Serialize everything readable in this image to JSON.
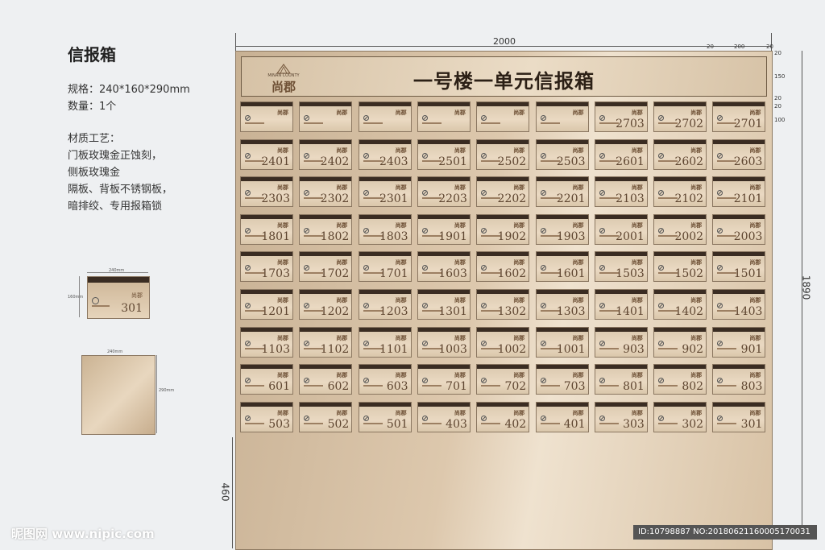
{
  "sidebar": {
    "title": "信报箱",
    "spec_size": "规格：240*160*290mm",
    "spec_qty": "数量：1个",
    "craft_title": "材质工艺：",
    "craft_lines": [
      "门板玫瑰金正蚀刻，",
      "侧板玫瑰金",
      "隔板、背板不锈钢板，",
      "暗排绞、专用报箱锁"
    ]
  },
  "panel": {
    "title": "一号楼一单元信报箱",
    "logo_en": "MINAN COUNTY",
    "logo_cn": "尚郡",
    "box_emblem": "尚郡"
  },
  "mailboxes": [
    [
      "",
      "",
      "",
      "",
      "",
      "",
      "2703",
      "2702",
      "2701"
    ],
    [
      "2401",
      "2402",
      "2403",
      "2501",
      "2502",
      "2503",
      "2601",
      "2602",
      "2603"
    ],
    [
      "2303",
      "2302",
      "2301",
      "2203",
      "2202",
      "2201",
      "2103",
      "2102",
      "2101"
    ],
    [
      "1801",
      "1802",
      "1803",
      "1901",
      "1902",
      "1903",
      "2001",
      "2002",
      "2003"
    ],
    [
      "1703",
      "1702",
      "1701",
      "1603",
      "1602",
      "1601",
      "1503",
      "1502",
      "1501"
    ],
    [
      "1201",
      "1202",
      "1203",
      "1301",
      "1302",
      "1303",
      "1401",
      "1402",
      "1403"
    ],
    [
      "1103",
      "1102",
      "1101",
      "1003",
      "1002",
      "1001",
      "903",
      "902",
      "901"
    ],
    [
      "601",
      "602",
      "603",
      "701",
      "702",
      "703",
      "801",
      "802",
      "803"
    ],
    [
      "503",
      "502",
      "501",
      "403",
      "402",
      "401",
      "303",
      "302",
      "301"
    ]
  ],
  "dimensions": {
    "width": "2000",
    "height": "1890",
    "bottom": "460",
    "top_a": "20",
    "top_b": "200",
    "top_c": "20",
    "right_a": "20",
    "right_b": "150",
    "right_c": "20",
    "right_d": "20",
    "right_e": "100"
  },
  "sketch": {
    "number": "301",
    "w_label": "240mm",
    "h_label": "160mm",
    "h2_label": "290mm"
  },
  "footer": {
    "watermark": "昵图网 www.nipic.com",
    "id_text": "ID:10798887 NO:20180621160005170031"
  }
}
